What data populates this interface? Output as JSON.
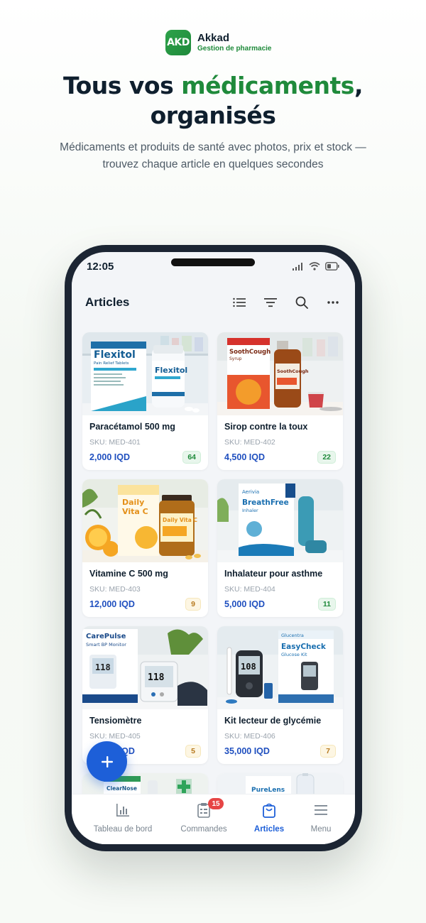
{
  "brand": {
    "logo_text": "AKD",
    "name": "Akkad",
    "tagline": "Gestion de pharmacie"
  },
  "hero": {
    "title_prefix": "Tous vos ",
    "title_accent": "médicaments",
    "title_suffix": ",",
    "title_line2": "organisés",
    "subtitle": "Médicaments et produits de santé avec photos, prix et stock — trouvez chaque article en quelques secondes"
  },
  "status_bar": {
    "time": "12:05"
  },
  "app_bar": {
    "title": "Articles",
    "actions": [
      "list-view-icon",
      "filter-icon",
      "search-icon",
      "more-icon"
    ]
  },
  "products": [
    {
      "name": "Paracétamol 500 mg",
      "sku": "SKU: MED-401",
      "price": "2,000 IQD",
      "stock": "64",
      "stock_level": "ok",
      "image": "Flexitol tablets box"
    },
    {
      "name": "Sirop contre la toux",
      "sku": "SKU: MED-402",
      "price": "4,500 IQD",
      "stock": "22",
      "stock_level": "ok",
      "image": "SoothCough syrup"
    },
    {
      "name": "Vitamine C 500 mg",
      "sku": "SKU: MED-403",
      "price": "12,000 IQD",
      "stock": "9",
      "stock_level": "low",
      "image": "Daily Vita C"
    },
    {
      "name": "Inhalateur pour asthme",
      "sku": "SKU: MED-404",
      "price": "5,000 IQD",
      "stock": "11",
      "stock_level": "ok",
      "image": "BreathFree inhaler"
    },
    {
      "name": "Tensiomètre",
      "sku": "SKU: MED-405",
      "price": "45,000 IQD",
      "stock": "5",
      "stock_level": "low",
      "image": "CarePulse Smart BP Monitor"
    },
    {
      "name": "Kit lecteur de glycémie",
      "sku": "SKU: MED-406",
      "price": "35,000 IQD",
      "stock": "7",
      "stock_level": "low",
      "image": "EasyCheck Glucose Kit"
    }
  ],
  "partial_products": [
    {
      "image": "ClearNose Nasal Spray"
    },
    {
      "image": "PureLens Solution"
    }
  ],
  "box_labels": {
    "flexitol": "Flexitol",
    "flexitol_sub": "Pain Relief Tablets",
    "sooth": "SoothCough",
    "sooth_sub": "Syrup",
    "vita": "Daily Vita C",
    "breath": "BreathFree",
    "breath_sub": "Inhaler",
    "breath_brand": "Aerivia",
    "carepulse": "CarePulse",
    "carepulse_sub": "Smart BP Monitor",
    "bp_reading": "118",
    "easycheck": "EasyCheck",
    "easycheck_sub": "Glucose Kit",
    "glucentra": "Glucentra",
    "glucose_reading": "108",
    "clearnose": "ClearNose",
    "purelens": "PureLens"
  },
  "tabbar": {
    "items": [
      {
        "label": "Tableau de bord",
        "icon": "bar-chart-icon"
      },
      {
        "label": "Commandes",
        "icon": "orders-icon",
        "badge": "15"
      },
      {
        "label": "Articles",
        "icon": "bag-icon",
        "active": true
      },
      {
        "label": "Menu",
        "icon": "menu-icon"
      }
    ]
  },
  "colors": {
    "brand_green": "#1f8a3b",
    "primary_blue": "#1d5fd8",
    "price_blue": "#1f4fbf",
    "badge_red": "#e64545"
  }
}
